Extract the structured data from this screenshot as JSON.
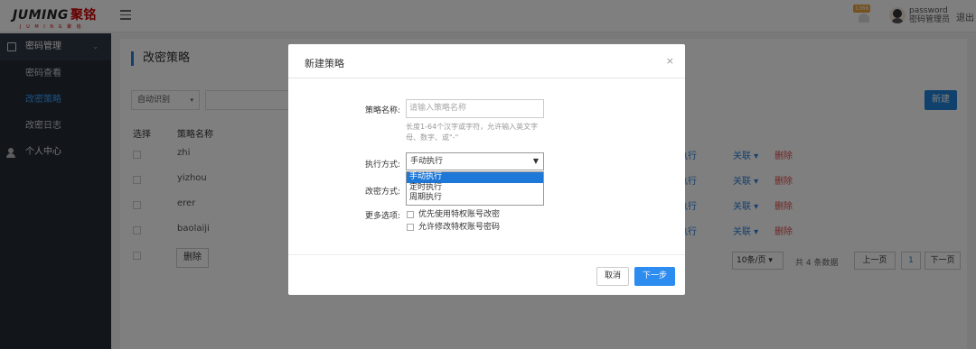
{
  "header": {
    "brand": "JUMING",
    "brand_cn": "聚铭",
    "tagline": "J U M I N G 聚 铭",
    "notification_count": "1366",
    "username": "password",
    "user_role": "密码管理员",
    "logout": "退出"
  },
  "sidebar": {
    "group1": {
      "label": "密码管理",
      "icon": "edit-icon"
    },
    "items": [
      {
        "label": "密码查看",
        "active": false
      },
      {
        "label": "改密策略",
        "active": true
      },
      {
        "label": "改密日志",
        "active": false
      }
    ],
    "group2": {
      "label": "个人中心",
      "icon": "user-icon"
    }
  },
  "main": {
    "title": "改密策略",
    "filter": {
      "selected": "自动识别"
    },
    "new_button": "新建",
    "columns": {
      "select": "选择",
      "name": "策略名称"
    },
    "rows": [
      {
        "name": "zhi",
        "run": "立即执行",
        "link": "关联",
        "delete": "删除"
      },
      {
        "name": "yizhou",
        "run": "立即执行",
        "link": "关联",
        "delete": "删除"
      },
      {
        "name": "erer",
        "run": "立即执行",
        "link": "关联",
        "delete": "删除"
      },
      {
        "name": "baolaiji",
        "run": "立即执行",
        "link": "关联",
        "delete": "删除"
      }
    ],
    "delete_button": "删除",
    "pager": {
      "page_size": "10条/页",
      "total": "共 4 条数据",
      "prev": "上一页",
      "page": "1",
      "next": "下一页"
    }
  },
  "modal": {
    "title": "新建策略",
    "close": "×",
    "name_label": "策略名称:",
    "name_placeholder": "请输入策略名称",
    "name_hint": "长度1-64个汉字或字符，允许输入英文字母、数字、或\"-\"",
    "exec_label": "执行方式:",
    "exec_selected": "手动执行",
    "exec_options": [
      "手动执行",
      "定时执行",
      "周期执行"
    ],
    "change_label": "改密方式:",
    "more_label": "更多选项:",
    "option1": "优先使用特权账号改密",
    "option2": "允许修改特权账号密码",
    "cancel": "取消",
    "next": "下一步"
  },
  "colors": {
    "sidebar_bg": "#252d37",
    "accent": "#2a7fd8",
    "primary_button": "#2d8cf0",
    "danger": "#e24b4b",
    "brand_red": "#cc0000"
  }
}
